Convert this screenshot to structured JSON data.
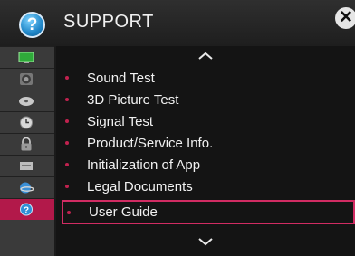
{
  "header": {
    "title": "SUPPORT",
    "help_icon_glyph": "?",
    "close_icon_glyph": "✕"
  },
  "menu": {
    "items": [
      {
        "label": "Sound Test"
      },
      {
        "label": "3D Picture Test"
      },
      {
        "label": "Signal Test"
      },
      {
        "label": "Product/Service Info."
      },
      {
        "label": "Initialization of App"
      },
      {
        "label": "Legal Documents"
      },
      {
        "label": "User Guide",
        "selected": true
      }
    ]
  },
  "sidebar": {
    "icons": [
      "picture-icon",
      "audio-icon",
      "disc-icon",
      "clock-icon",
      "lock-icon",
      "option-icon",
      "network-icon",
      "support-icon"
    ]
  },
  "colors": {
    "accent": "#b2194a",
    "text": "#f1f1f1"
  }
}
